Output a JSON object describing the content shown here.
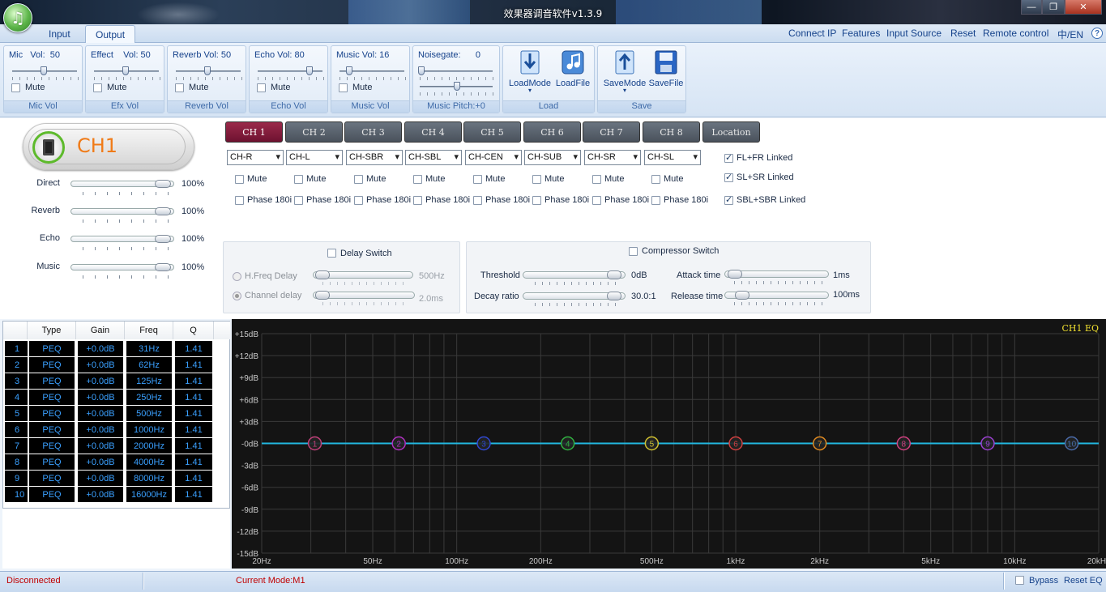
{
  "window": {
    "title": "效果器调音软件v1.3.9",
    "controls": [
      "—",
      "❐",
      "✕"
    ]
  },
  "tabs": [
    {
      "label": "Input",
      "active": false
    },
    {
      "label": "Output",
      "active": true
    }
  ],
  "top_links": [
    "Connect IP",
    "Features",
    "Input Source",
    "Reset",
    "Remote control",
    "中/EN"
  ],
  "help_icon": "?",
  "ribbon": {
    "mic": {
      "title": "Mic   Vol:  50",
      "mute": "Mute",
      "label": "Mic Vol"
    },
    "effect": {
      "title": "Effect    Vol: 50",
      "mute": "Mute",
      "label": "Efx Vol"
    },
    "reverb": {
      "title": "Reverb Vol: 50",
      "mute": "Mute",
      "label": "Reverb Vol"
    },
    "echo": {
      "title": "Echo Vol: 80",
      "mute": "Mute",
      "label": "Echo Vol"
    },
    "music": {
      "title": "Music Vol: 16",
      "mute": "Mute",
      "label": "Music Vol"
    },
    "noisegate": {
      "title": "Noisegate:      0",
      "label": "Music Pitch:+0"
    },
    "load": {
      "load_mode": "LoadMode",
      "load_file": "LoadFile",
      "label": "Load"
    },
    "save": {
      "save_mode": "SaveMode",
      "save_file": "SaveFile",
      "label": "Save"
    }
  },
  "channel": {
    "name": "CH1",
    "mix": [
      {
        "label": "Direct",
        "pct": "100%"
      },
      {
        "label": "Reverb",
        "pct": "100%"
      },
      {
        "label": "Echo",
        "pct": "100%"
      },
      {
        "label": "Music",
        "pct": "100%"
      }
    ]
  },
  "ch_tabs": [
    "CH 1",
    "CH 2",
    "CH 3",
    "CH 4",
    "CH 5",
    "CH 6",
    "CH 7",
    "CH 8",
    "Location"
  ],
  "ch_outputs": [
    "CH-R",
    "CH-L",
    "CH-SBR",
    "CH-SBL",
    "CH-CEN",
    "CH-SUB",
    "CH-SR",
    "CH-SL"
  ],
  "mute_label": "Mute",
  "phase_label": "Phase 180i",
  "linked": [
    {
      "label": "FL+FR Linked",
      "checked": true
    },
    {
      "label": "SL+SR Linked",
      "checked": true
    },
    {
      "label": "SBL+SBR Linked",
      "checked": true
    }
  ],
  "delay": {
    "switch": "Delay Switch",
    "hfreq_label": "H.Freq Delay",
    "hfreq_value": "500Hz",
    "channel_label": "Channel delay",
    "channel_value": "2.0ms"
  },
  "compressor": {
    "switch": "Compressor Switch",
    "threshold_label": "Threshold",
    "threshold_value": "0dB",
    "decay_label": "Decay ratio",
    "decay_value": "30.0:1",
    "attack_label": "Attack time",
    "attack_value": "1ms",
    "release_label": "Release time",
    "release_value": "100ms"
  },
  "eq_table": {
    "headers": [
      "Type",
      "Gain",
      "Freq",
      "Q"
    ],
    "rows": [
      {
        "n": "1",
        "type": "PEQ",
        "gain": "+0.0dB",
        "freq": "31Hz",
        "q": "1.41"
      },
      {
        "n": "2",
        "type": "PEQ",
        "gain": "+0.0dB",
        "freq": "62Hz",
        "q": "1.41"
      },
      {
        "n": "3",
        "type": "PEQ",
        "gain": "+0.0dB",
        "freq": "125Hz",
        "q": "1.41"
      },
      {
        "n": "4",
        "type": "PEQ",
        "gain": "+0.0dB",
        "freq": "250Hz",
        "q": "1.41"
      },
      {
        "n": "5",
        "type": "PEQ",
        "gain": "+0.0dB",
        "freq": "500Hz",
        "q": "1.41"
      },
      {
        "n": "6",
        "type": "PEQ",
        "gain": "+0.0dB",
        "freq": "1000Hz",
        "q": "1.41"
      },
      {
        "n": "7",
        "type": "PEQ",
        "gain": "+0.0dB",
        "freq": "2000Hz",
        "q": "1.41"
      },
      {
        "n": "8",
        "type": "PEQ",
        "gain": "+0.0dB",
        "freq": "4000Hz",
        "q": "1.41"
      },
      {
        "n": "9",
        "type": "PEQ",
        "gain": "+0.0dB",
        "freq": "8000Hz",
        "q": "1.41"
      },
      {
        "n": "10",
        "type": "PEQ",
        "gain": "+0.0dB",
        "freq": "16000Hz",
        "q": "1.41"
      }
    ]
  },
  "graph": {
    "title": "CH1 EQ",
    "y_labels": [
      "+15dB",
      "+12dB",
      "+9dB",
      "+6dB",
      "+3dB",
      "-0dB",
      "-3dB",
      "-6dB",
      "-9dB",
      "-12dB",
      "-15dB"
    ],
    "x_labels": [
      "20Hz",
      "50Hz",
      "100Hz",
      "200Hz",
      "500Hz",
      "1kHz",
      "2kHz",
      "5kHz",
      "10kHz",
      "20kHz"
    ],
    "x_label_freqs": [
      20,
      50,
      100,
      200,
      500,
      1000,
      2000,
      5000,
      10000,
      20000
    ],
    "points": [
      {
        "label": "1",
        "freq": 31,
        "gain": 0,
        "color": "#c0407a"
      },
      {
        "label": "2",
        "freq": 62,
        "gain": 0,
        "color": "#b030c0"
      },
      {
        "label": "3",
        "freq": 125,
        "gain": 0,
        "color": "#3048d0"
      },
      {
        "label": "4",
        "freq": 250,
        "gain": 0,
        "color": "#30b040"
      },
      {
        "label": "5",
        "freq": 500,
        "gain": 0,
        "color": "#d0c030"
      },
      {
        "label": "6",
        "freq": 1000,
        "gain": 0,
        "color": "#d04040"
      },
      {
        "label": "7",
        "freq": 2000,
        "gain": 0,
        "color": "#e08a20"
      },
      {
        "label": "8",
        "freq": 4000,
        "gain": 0,
        "color": "#d04080"
      },
      {
        "label": "9",
        "freq": 8000,
        "gain": 0,
        "color": "#9a40d0"
      },
      {
        "label": "10",
        "freq": 16000,
        "gain": 0,
        "color": "#4a6aa8"
      }
    ],
    "line_color": "#22b8e0",
    "title_color": "#f0e030"
  },
  "status": {
    "connection": "Disconnected",
    "mode": "Current Mode:M1",
    "bypass": "Bypass",
    "reset_eq": "Reset EQ"
  }
}
